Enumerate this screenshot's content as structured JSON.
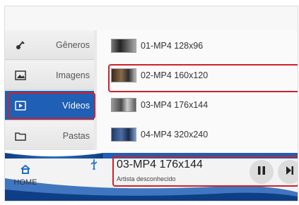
{
  "sidebar": {
    "items": [
      {
        "label": "Gêneros",
        "icon": "guitar-icon"
      },
      {
        "label": "Imagens",
        "icon": "image-icon"
      },
      {
        "label": "Vídeos",
        "icon": "video-icon"
      },
      {
        "label": "Pastas",
        "icon": "folder-icon"
      }
    ],
    "selected": "Vídeos"
  },
  "videos": [
    {
      "name": "01-MP4 128x96"
    },
    {
      "name": "02-MP4 160x120"
    },
    {
      "name": "03-MP4 176x144"
    },
    {
      "name": "04-MP4 320x240"
    }
  ],
  "bottom_bar": {
    "home_label": "HOME",
    "usb_icon": "usb-icon",
    "now_playing": {
      "title": "03-MP4 176x144",
      "artist": "Artista desconhecido"
    },
    "pause_icon": "pause-icon",
    "next_icon": "next-icon"
  },
  "colors": {
    "accent": "#1f5fb5",
    "highlight": "#d0202a"
  }
}
